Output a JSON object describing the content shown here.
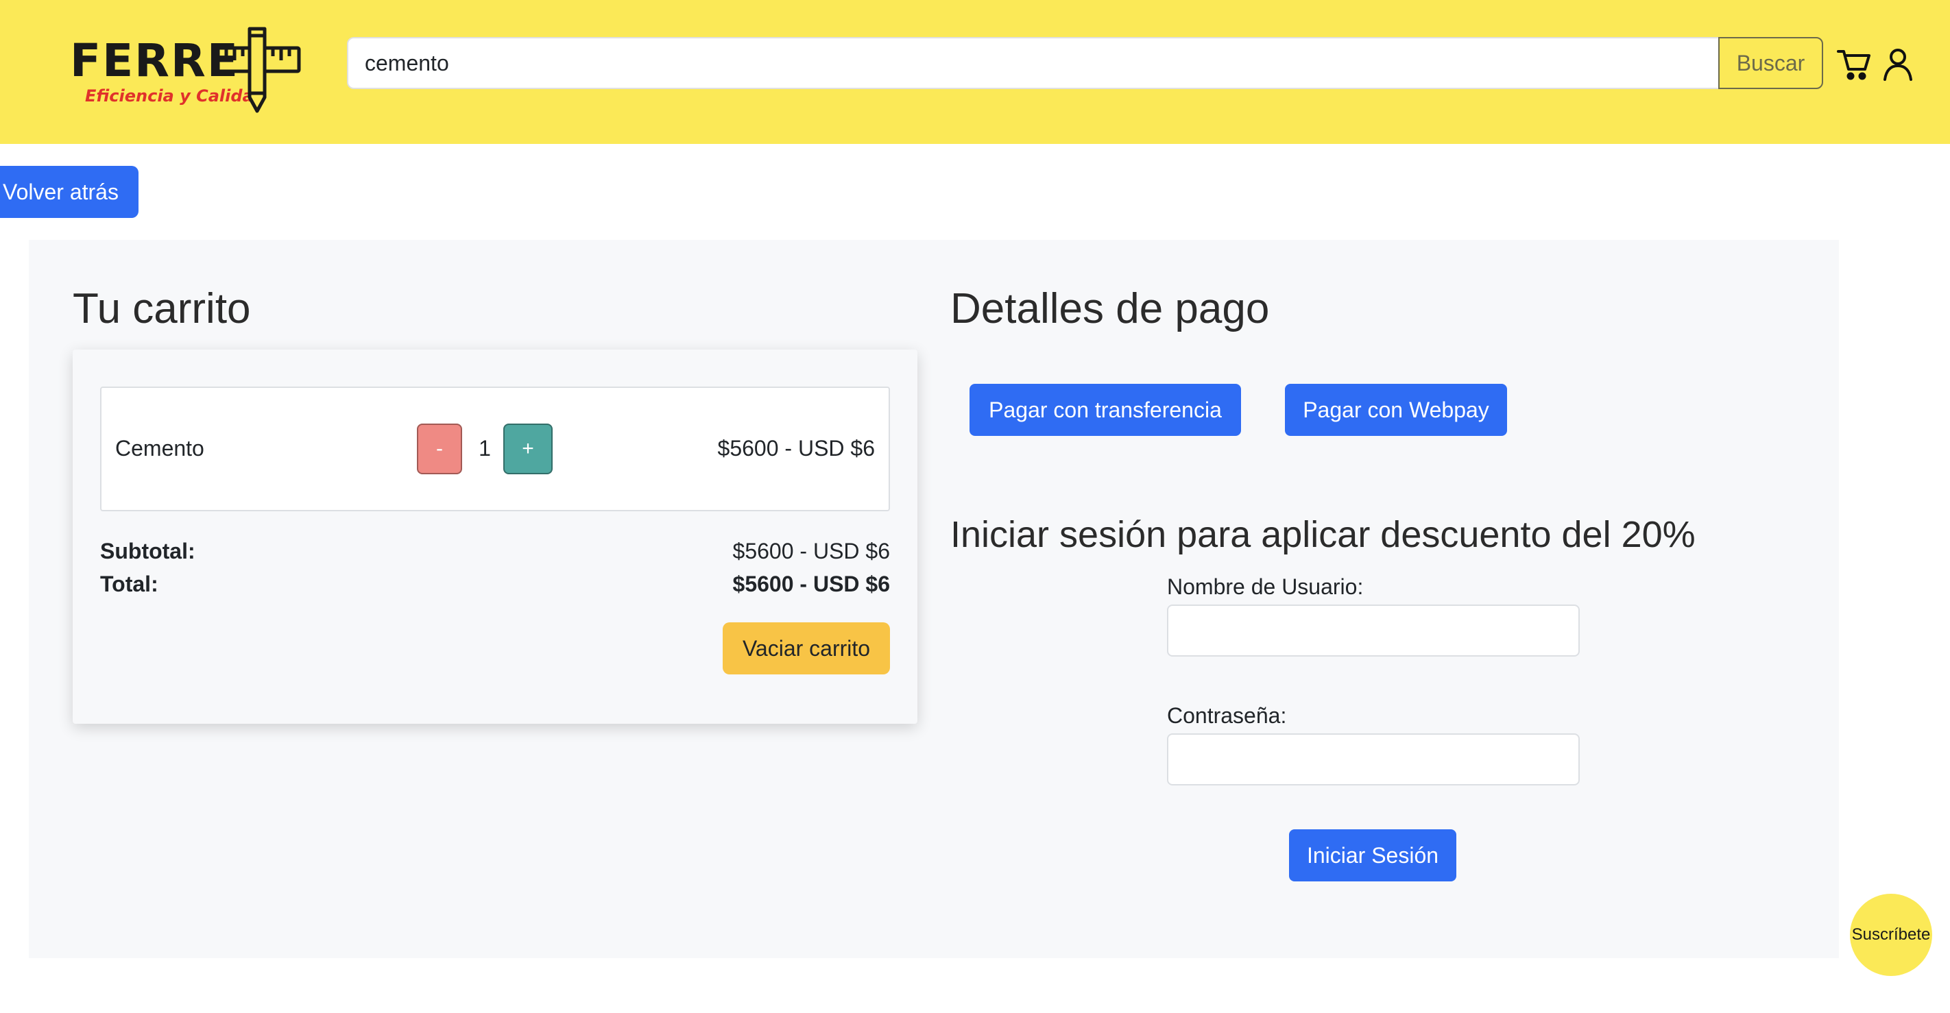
{
  "header": {
    "logo_text": "FERRE",
    "logo_tagline": "Eficiencia y Calidad",
    "search_value": "cemento",
    "search_button": "Buscar",
    "icons": [
      "cart-icon",
      "user-icon"
    ]
  },
  "back_button": "Volver atrás",
  "cart": {
    "title": "Tu carrito",
    "items": [
      {
        "name": "Cemento",
        "minus": "-",
        "quantity": "1",
        "plus": "+",
        "price": "$5600 - USD $6"
      }
    ],
    "subtotal_label": "Subtotal:",
    "subtotal_value": "$5600 - USD $6",
    "total_label": "Total:",
    "total_value": "$5600 - USD $6",
    "clear_button": "Vaciar carrito"
  },
  "payment": {
    "title": "Detalles de pago",
    "transfer_button": "Pagar con transferencia",
    "webpay_button": "Pagar con Webpay"
  },
  "login": {
    "title": "Iniciar sesión para aplicar descuento del 20%",
    "username_label": "Nombre de Usuario:",
    "username_value": "",
    "password_label": "Contraseña:",
    "password_value": "",
    "submit_button": "Iniciar Sesión"
  },
  "subscribe_button": "Suscríbete",
  "colors": {
    "header_bg": "#fbe957",
    "primary": "#2f6cf3",
    "minus": "#ef8a84",
    "plus": "#4fa7a0",
    "warning": "#f8c446",
    "tagline": "#e0312b"
  }
}
